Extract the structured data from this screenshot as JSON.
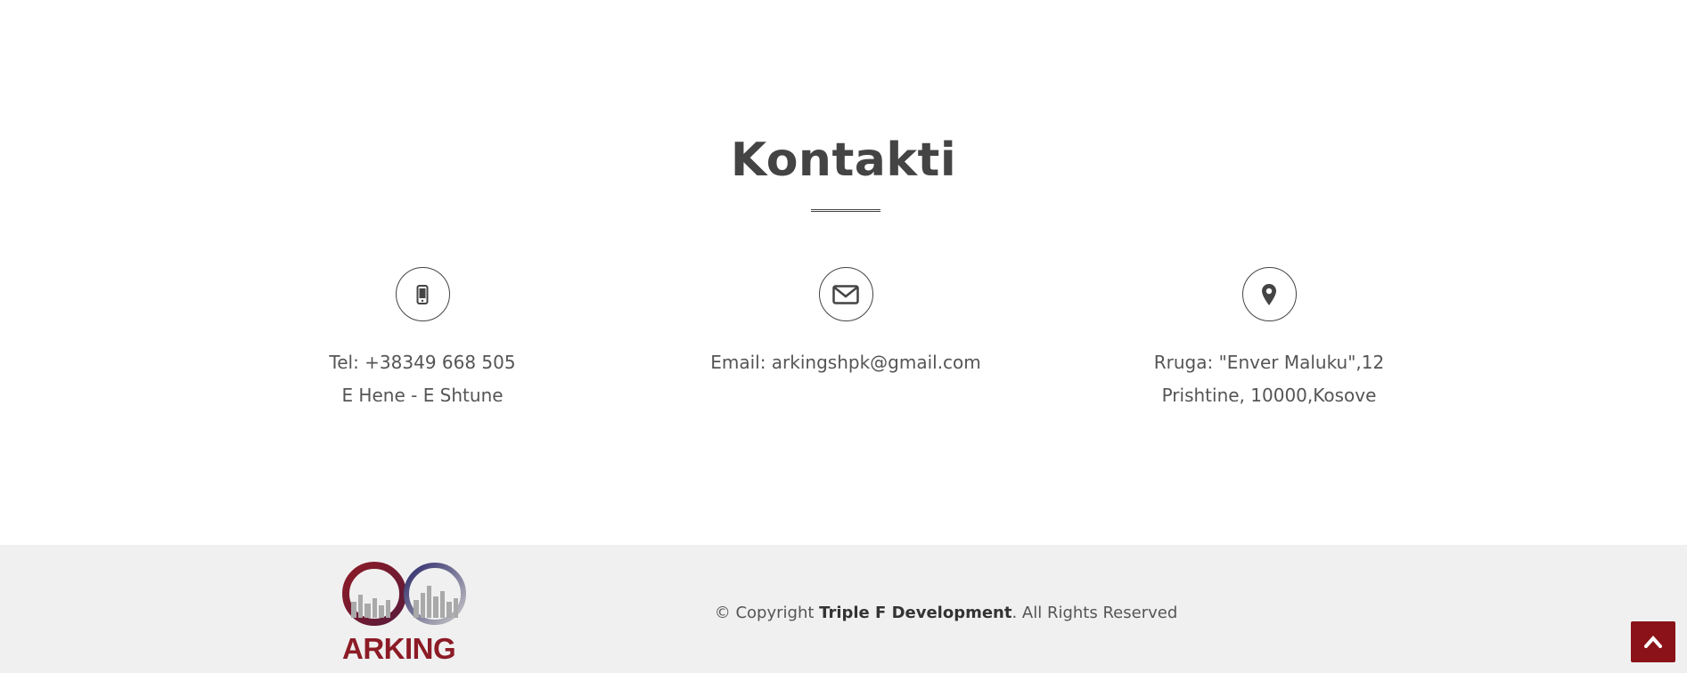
{
  "contact": {
    "title": "Kontakti",
    "phone": {
      "icon": "mobile-phone-icon",
      "line1": "Tel: +38349 668 505",
      "line2": "E Hene - E Shtune"
    },
    "email": {
      "icon": "envelope-icon",
      "line1": "Email: arkingshpk@gmail.com"
    },
    "address": {
      "icon": "map-marker-icon",
      "line1": "Rruga: \"Enver Maluku\",12",
      "line2": "Prishtine, 10000,Kosove"
    }
  },
  "footer": {
    "logo_text": "ARKING",
    "copyright_prefix": "© Copyright ",
    "copyright_company": "Triple F Development",
    "copyright_suffix": ". All Rights Reserved",
    "scroll_top_icon": "chevron-up-icon"
  },
  "colors": {
    "brand": "#8a1218",
    "text": "#444444",
    "footer_bg": "#f0f0f0"
  }
}
